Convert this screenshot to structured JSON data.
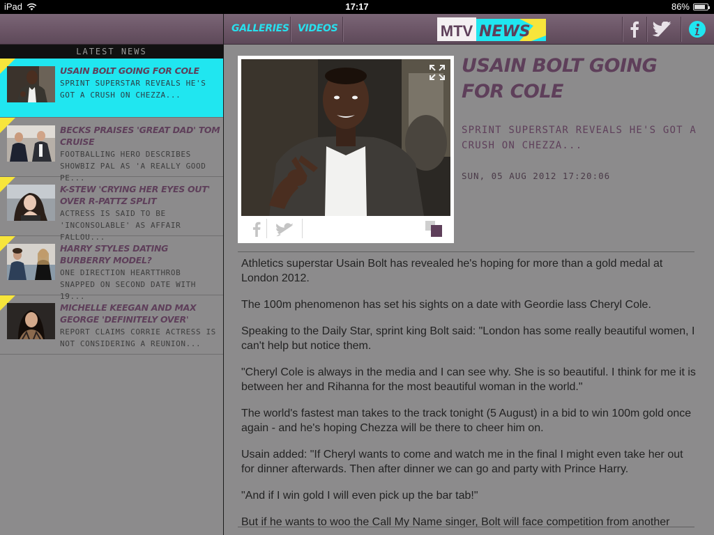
{
  "status": {
    "device": "iPad",
    "time": "17:17",
    "battery": "86%",
    "battery_level": 0.86
  },
  "sidebar": {
    "header": "LATEST NEWS",
    "items": [
      {
        "title": "USAIN BOLT GOING FOR COLE",
        "summary": "SPRINT SUPERSTAR REVEALS HE'S\nGOT A CRUSH ON CHEZZA...",
        "active": true
      },
      {
        "title": "BECKS PRAISES 'GREAT DAD' TOM CRUISE",
        "summary": "FOOTBALLING HERO DESCRIBES\nSHOWBIZ PAL AS 'A REALLY GOOD PE...",
        "active": false
      },
      {
        "title": "K-STEW 'CRYING HER EYES OUT' OVER R-PATTZ SPLIT",
        "summary": "ACTRESS IS SAID TO BE\n'INCONSOLABLE' AS AFFAIR FALLOU...",
        "active": false
      },
      {
        "title": "HARRY STYLES DATING BURBERRY MODEL?",
        "summary": "ONE DIRECTION HEARTTHROB\nSNAPPED ON SECOND DATE WITH 19...",
        "active": false
      },
      {
        "title": "MICHELLE KEEGAN AND MAX GEORGE 'DEFINITELY OVER'",
        "summary": "REPORT CLAIMS CORRIE ACTRESS IS\nNOT CONSIDERING A REUNION...",
        "active": false
      }
    ]
  },
  "header": {
    "nav": [
      "GALLERIES",
      "VIDEOS"
    ],
    "logo_text": "MTV",
    "logo_news": "NEWS",
    "icons": [
      "facebook-icon",
      "twitter-icon",
      "info-icon"
    ]
  },
  "article": {
    "title": "USAIN BOLT GOING FOR COLE",
    "subtitle": "SPRINT SUPERSTAR REVEALS HE'S GOT A CRUSH ON CHEZZA...",
    "date": "SUN, 05 AUG 2012 17:20:06",
    "paragraphs": [
      "Athletics superstar Usain Bolt has revealed he's hoping for more than a gold medal at London 2012.",
      "The 100m phenomenon has set his sights on a date with Geordie lass Cheryl Cole.",
      "Speaking to the Daily Star, sprint king Bolt said: \"London has some really beautiful women, I can't help but notice them.",
      "\"Cheryl Cole is always in the media and I can see why. She is so beautiful. I think for me it is between her and Rihanna for the most beautiful woman in the world.\"",
      "The world's fastest man takes to the track tonight (5 August) in a bid to win 100m gold once again - and he's hoping Chezza will be there to cheer him on.",
      "Usain added: \"If Cheryl wants to come and watch me in the final I might even take her out for dinner afterwards. Then after dinner we can go and party with Prince Harry.",
      "\"And if I win gold I will even pick up the bar tab!\"",
      "But if he wants to woo the Call My Name singer, Bolt will face competition from another"
    ]
  },
  "colors": {
    "accent_cyan": "#20e6f0",
    "yellow": "#f7e53b",
    "purple": "#5e3f5a",
    "header": "#6b5566",
    "panel": "#8c8b8c"
  }
}
